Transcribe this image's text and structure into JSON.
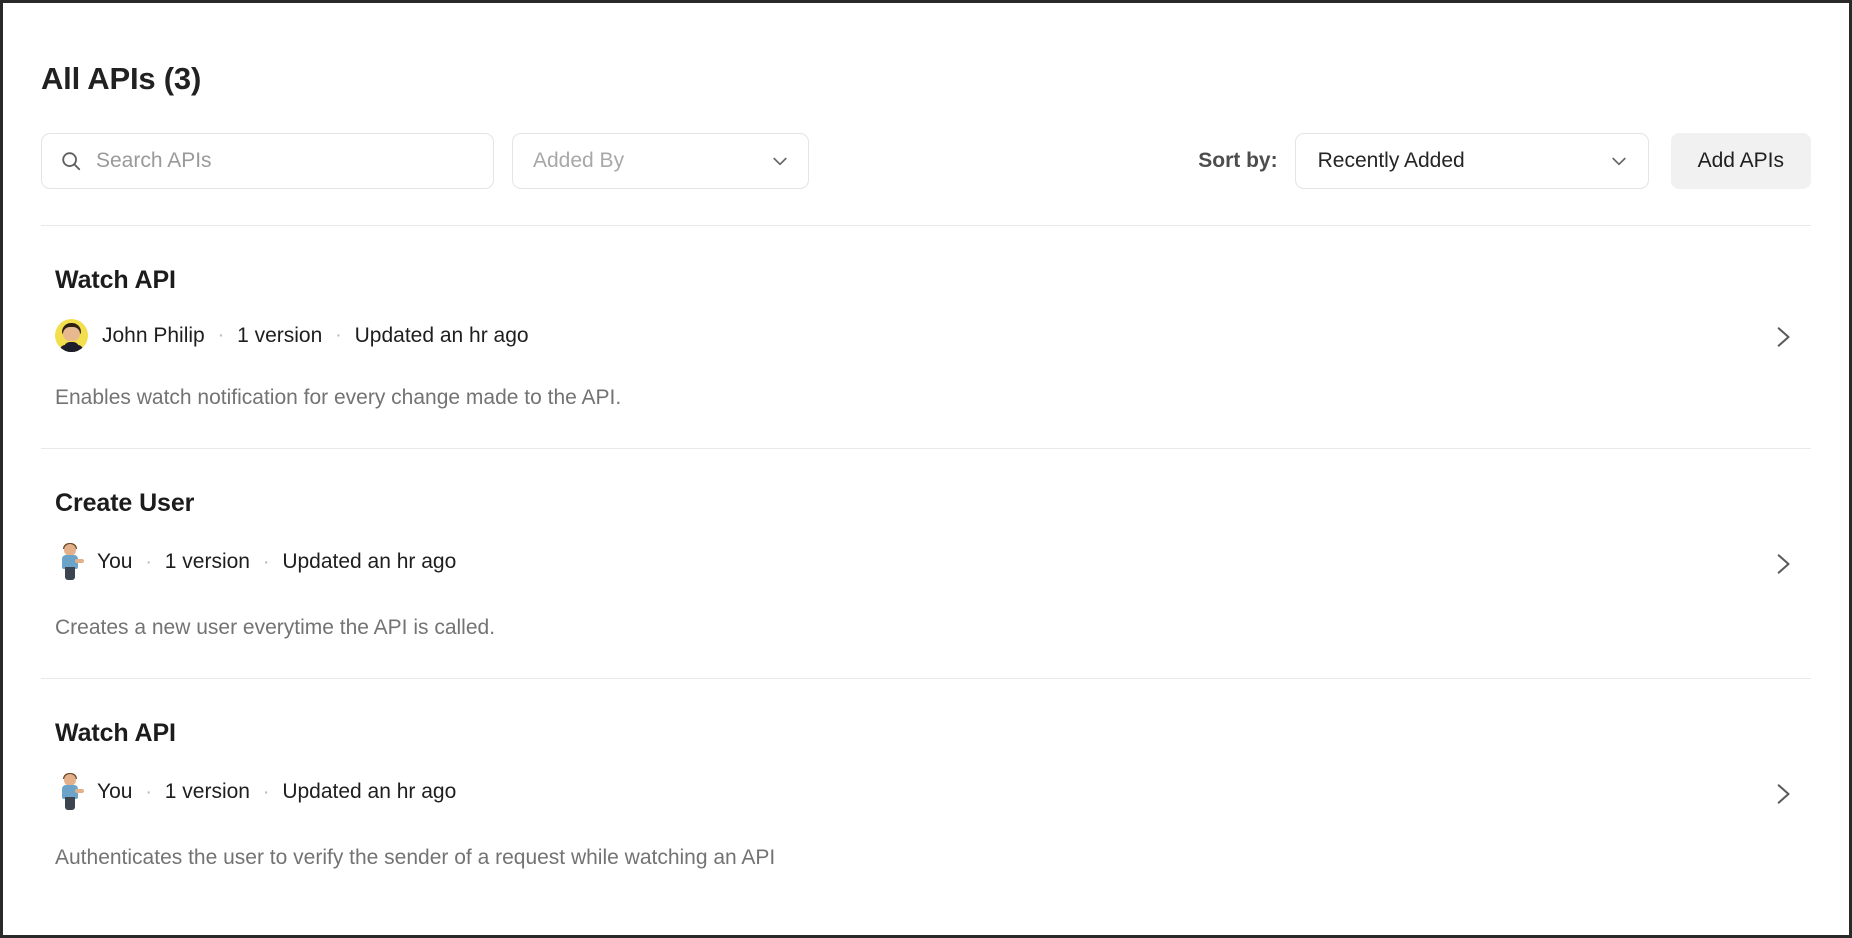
{
  "header": {
    "title": "All APIs (3)"
  },
  "toolbar": {
    "search": {
      "placeholder": "Search APIs",
      "value": "",
      "icon": "search-icon"
    },
    "added_by_filter": {
      "label": "Added By",
      "icon": "chevron-down-icon"
    },
    "sort": {
      "label": "Sort by:",
      "value": "Recently Added",
      "icon": "chevron-down-icon"
    },
    "add_apis_button": {
      "label": "Add APIs"
    }
  },
  "apis": [
    {
      "name": "Watch API",
      "author": "John Philip",
      "avatar_type": "photo",
      "versions": "1 version",
      "updated": "Updated an hr ago",
      "description": "Enables watch notification for every change made to the API.",
      "separator": "·",
      "chevron": "chevron-right-icon"
    },
    {
      "name": "Create User",
      "author": "You",
      "avatar_type": "figure",
      "versions": "1 version",
      "updated": "Updated an hr ago",
      "description": "Creates a new user everytime the API is called.",
      "separator": "·",
      "chevron": "chevron-right-icon"
    },
    {
      "name": "Watch API",
      "author": "You",
      "avatar_type": "figure",
      "versions": "1 version",
      "updated": "Updated an hr ago",
      "description": "Authenticates the user to verify the sender of a request while watching an API",
      "separator": "·",
      "chevron": "chevron-right-icon"
    }
  ],
  "colors": {
    "text_primary": "#1c1c1c",
    "text_muted": "#737373",
    "border": "#e4e4e4",
    "divider": "#e9e9e9",
    "button_bg": "#f1f1f1",
    "avatar_bg": "#f3de4e"
  }
}
